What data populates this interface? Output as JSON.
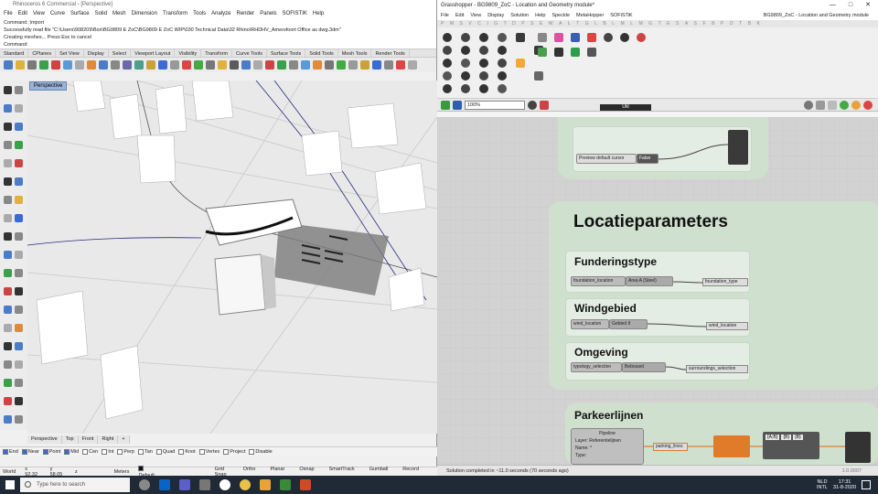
{
  "rhino": {
    "title": "Rhinoceros 6 Commercial - [Perspective]",
    "menu": [
      "File",
      "Edit",
      "View",
      "Curve",
      "Surface",
      "Solid",
      "Mesh",
      "Dimension",
      "Transform",
      "Tools",
      "Analyze",
      "Render",
      "Panels",
      "SOFISTIK",
      "Help"
    ],
    "command_lines": [
      "Command: Import",
      "Successfully read file \"C:\\Users\\908209\\Box\\BG9809 E ZoC\\BG9809 E ZoC WIP\\030 Technical Data\\32 Rhino\\RHDHV_Amersfoort Office as dwg.3dm\"",
      "Creating meshes... Press Esc to cancel",
      "Command:"
    ],
    "tabs": [
      "Standard",
      "CPlanes",
      "Set View",
      "Display",
      "Select",
      "Viewport Layout",
      "Visibility",
      "Transform",
      "Curve Tools",
      "Surface Tools",
      "Solid Tools",
      "Mesh Tools",
      "Render Tools"
    ],
    "viewport_label": "Perspective",
    "view_tabs": [
      "Perspective",
      "Top",
      "Front",
      "Right",
      "+"
    ],
    "osnaps": [
      {
        "label": "End",
        "on": true
      },
      {
        "label": "Near",
        "on": true
      },
      {
        "label": "Point",
        "on": true
      },
      {
        "label": "Mid",
        "on": true
      },
      {
        "label": "Cen",
        "on": false
      },
      {
        "label": "Int",
        "on": false
      },
      {
        "label": "Perp",
        "on": false
      },
      {
        "label": "Tan",
        "on": false
      },
      {
        "label": "Quad",
        "on": false
      },
      {
        "label": "Knot",
        "on": false
      },
      {
        "label": "Vertex",
        "on": false
      },
      {
        "label": "Project",
        "on": false
      },
      {
        "label": "Disable",
        "on": false
      }
    ],
    "status": {
      "cplane": "World",
      "x": "x 92.32",
      "y": "y 58.05",
      "z": "z",
      "units": "Meters",
      "layer": "Default",
      "modes": [
        "Grid Snap",
        "Ortho",
        "Planar",
        "Osnap",
        "SmartTrack",
        "Gumball",
        "Record"
      ]
    }
  },
  "grasshopper": {
    "title": "Grasshopper - BG9809_ZoC - Location and Geometry module*",
    "menu": [
      "File",
      "Edit",
      "View",
      "Display",
      "Solution",
      "Help",
      "Speckle",
      "MetaHopper",
      "SOFiSTiK"
    ],
    "doc_name": "BG9809_ZoC - Location and Geometry module",
    "alphabet": [
      "P",
      "M",
      "S",
      "V",
      "C",
      "I",
      "G",
      "T",
      "D",
      "P",
      "S",
      "E",
      "W",
      "A",
      "L",
      "T",
      "G",
      "L",
      "B",
      "L",
      "M",
      "L",
      "M",
      "G",
      "T",
      "E",
      "S",
      "A",
      "S",
      "F",
      "B",
      "P",
      "O",
      "T",
      "B",
      "K"
    ],
    "categories": [
      "Geometry",
      "Primitive",
      "Input",
      "Util"
    ],
    "zoom": "100%",
    "preview_toggle": {
      "label": "Preview default cursor",
      "value": "False"
    },
    "groups": [
      {
        "title": "Locatieparameters"
      },
      {
        "title": "Funderingstype",
        "input": "foundation_location",
        "value": "Area A (Steel)",
        "output": "foundation_type"
      },
      {
        "title": "Windgebied",
        "input": "wind_location",
        "value": "Gebied II",
        "output": "wind_location"
      },
      {
        "title": "Omgeving",
        "input": "typology_selection",
        "value": "Bebouwd",
        "output": "surroundings_selection"
      },
      {
        "title": "Parkeerlijnen",
        "pipeline": "Pipeline",
        "layer": "Layer: Referentielijnen",
        "name": "Name: *",
        "type": "Type:",
        "output": "parking_lines",
        "panel_values": [
          "{A;B}",
          "{B}",
          "{B}"
        ]
      }
    ],
    "status": "Solution completed in ~11.0 seconds (70 seconds ago)",
    "version": "1.0.0007"
  },
  "taskbar": {
    "search_placeholder": "Type here to search",
    "lang": "NLD",
    "layout": "INTL",
    "time": "17:31",
    "date": "31-8-2020"
  },
  "colors": {
    "group_green": "#cfe0cf",
    "canvas": "#d2d2d2",
    "viewport": "#e9e9e9",
    "taskbar": "#1f2a36",
    "orange_wire": "#e07b2a"
  }
}
